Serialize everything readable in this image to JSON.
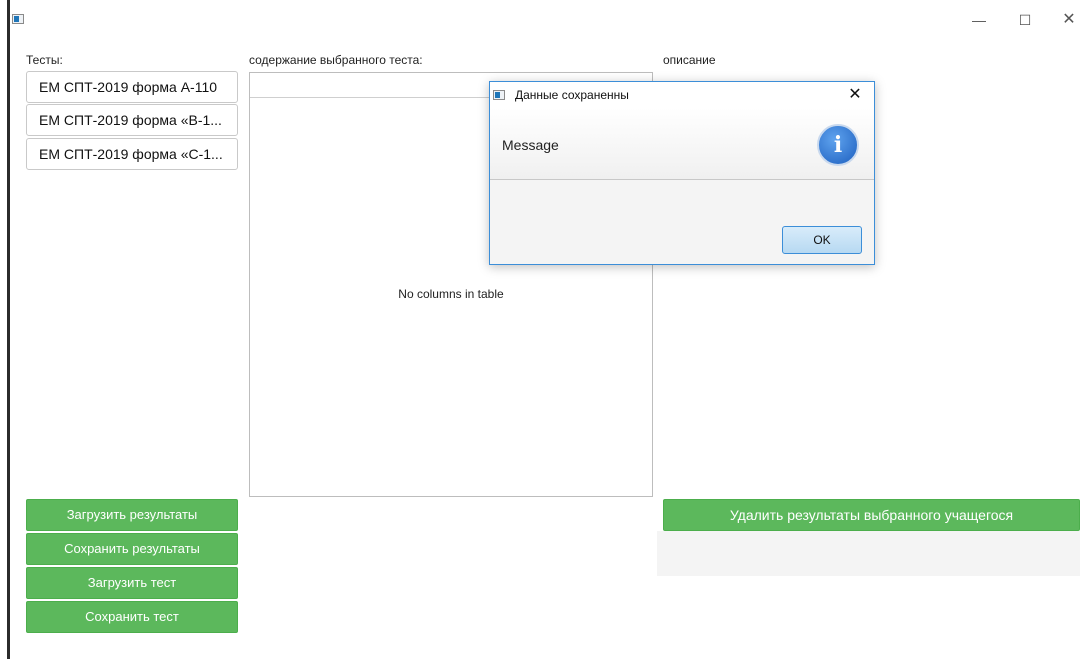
{
  "window": {
    "title": "",
    "controls": {
      "minimize": "—",
      "maximize": "☐",
      "close": "✕"
    }
  },
  "labels": {
    "tests": "Тесты:",
    "content": "содержание выбранного теста:",
    "description": "описание"
  },
  "tests": [
    {
      "label": "ЕМ СПТ-2019 форма А-110"
    },
    {
      "label": "ЕМ СПТ-2019 форма «В-1..."
    },
    {
      "label": "ЕМ СПТ-2019 форма «С-1..."
    }
  ],
  "table": {
    "empty_text": "No columns in table"
  },
  "actions": {
    "load_results": "Загрузить результаты",
    "save_results": "Сохранить результаты",
    "load_test": "Загрузить тест",
    "save_test": "Сохранить тест",
    "delete_student_results": "Удалить результаты выбранного учащегося"
  },
  "dialog": {
    "title": "Данные сохраненны",
    "message": "Message",
    "info_glyph": "i",
    "close_glyph": "✕",
    "ok_label": "OK"
  },
  "colors": {
    "accent_green": "#5cb85c",
    "dialog_border": "#3c8ed8",
    "info_blue": "#1d5fbf"
  },
  "icons": [
    "app-icon",
    "minimize-icon",
    "maximize-icon",
    "close-icon",
    "info-icon"
  ]
}
